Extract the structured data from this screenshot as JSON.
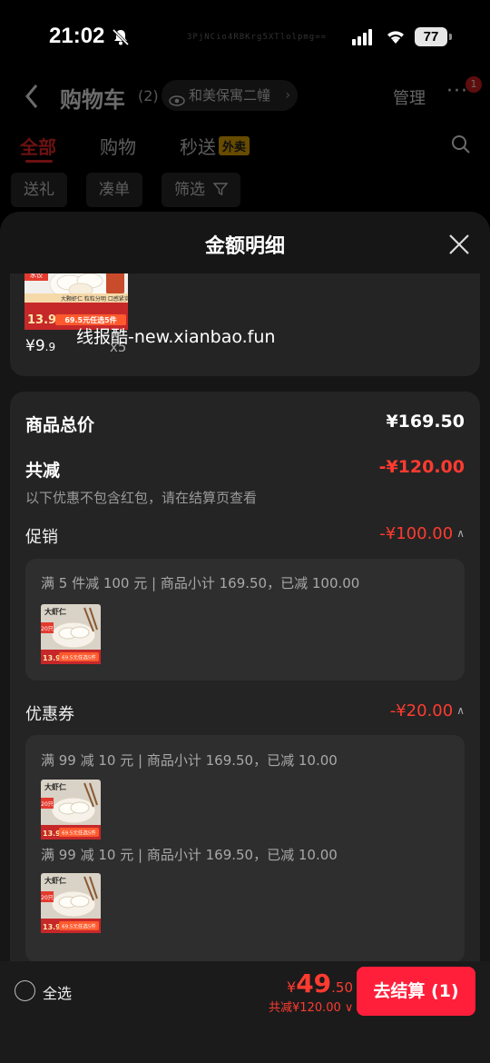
{
  "status_bar": {
    "time": "21:02",
    "battery": "77",
    "overlay_code": "3PjNCio4RBKrg5XTlolpmg=="
  },
  "header": {
    "title": "购物车",
    "count": "(2)",
    "address": "和美保寓二幢",
    "manage": "管理",
    "more": "···",
    "badge": "1"
  },
  "tabs": [
    {
      "label": "全部"
    },
    {
      "label": "购物"
    },
    {
      "label": "秒送"
    }
  ],
  "takeout_tag": "外卖",
  "chips": [
    {
      "label": "送礼"
    },
    {
      "label": "凑单"
    },
    {
      "label": "筛选"
    }
  ],
  "sheet": {
    "title": "金额明细",
    "item": {
      "price_main": "¥9",
      "price_cents": ".9",
      "qty": "x5"
    },
    "total": {
      "label": "商品总价",
      "value": "¥169.50"
    },
    "reduce": {
      "label": "共减",
      "value": "-¥120.00"
    },
    "note": "以下优惠不包含红包，请在结算页查看",
    "watermark": "线报酷-new.xianbao.fun",
    "promo": {
      "label": "促销",
      "value": "-¥100.00",
      "line": "满 5 件减 100 元 | 商品小计 169.50，已减 100.00"
    },
    "coupon": {
      "label": "优惠券",
      "value": "-¥20.00",
      "lines": [
        "满 99 减 10 元 | 商品小计 169.50，已减 10.00",
        "满 99 减 10 元 | 商品小计 169.50，已减 10.00"
      ]
    },
    "thumb_text": {
      "top_badge": "20只",
      "top_sub": "水饺",
      "price": "13.9",
      "promo": "69.5元任选5件",
      "brand": "大虾仁",
      "strip": "大颗虾仁 粒粒分明 口感紧实"
    }
  },
  "bottom": {
    "select_all": "全选",
    "total_symbol": "¥",
    "total_main": "49",
    "total_cents": ".50",
    "discount": "共减¥120.00",
    "checkout": "去结算 (1)"
  },
  "colors": {
    "accent_red": "#ff3b30",
    "checkout_red": "#ff1f3a",
    "sheet_bg": "#161616",
    "card_bg": "#242424"
  }
}
